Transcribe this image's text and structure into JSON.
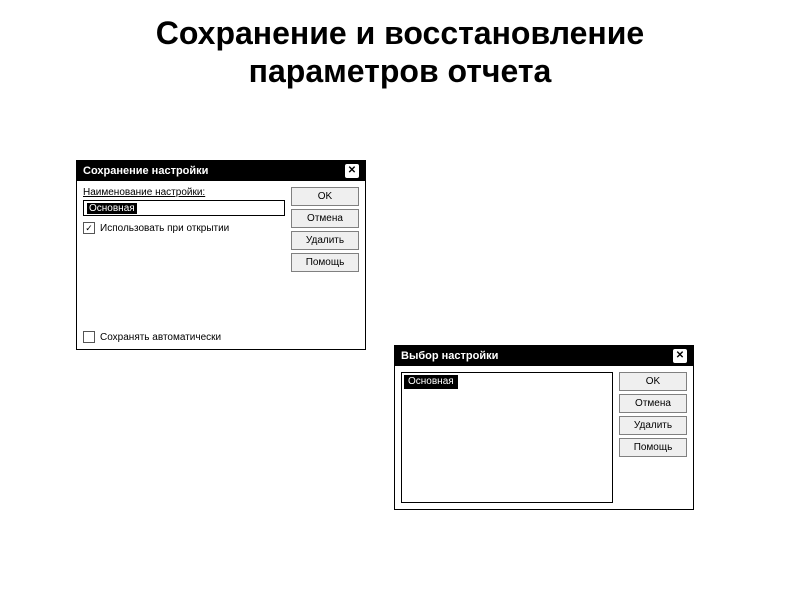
{
  "slide": {
    "title_line1": "Сохранение и восстановление",
    "title_line2": "параметров отчета"
  },
  "dialog_save": {
    "title": "Сохранение настройки",
    "name_label": "Наименование настройки:",
    "name_value": "Основная",
    "use_on_open": "Использовать при открытии",
    "use_on_open_checked": "✓",
    "auto_save": "Сохранять автоматически",
    "auto_save_checked": "",
    "buttons": {
      "ok": "OK",
      "cancel": "Отмена",
      "delete": "Удалить",
      "help": "Помощь"
    }
  },
  "dialog_select": {
    "title": "Выбор настройки",
    "list_selected": "Основная",
    "buttons": {
      "ok": "OK",
      "cancel": "Отмена",
      "delete": "Удалить",
      "help": "Помощь"
    }
  }
}
